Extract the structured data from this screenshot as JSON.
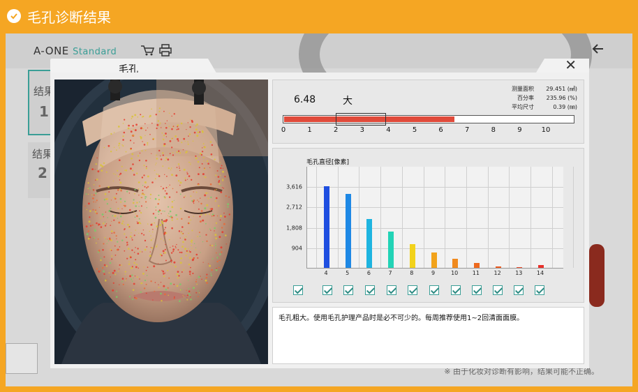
{
  "titlebar": {
    "title": "毛孔诊断结果",
    "icon": "check-circle-icon"
  },
  "bg_app": {
    "logo_main": "A-ONE",
    "logo_sub": "Standard",
    "frag_1": "结果",
    "frag_1_value": "1",
    "frag_2": "结果",
    "frag_2_value": "2",
    "bottom_note": "※ 由于化妆对诊断有影响，结果可能不正确。"
  },
  "dialog": {
    "tab_label": "毛孔",
    "close_symbol": "✕",
    "summary": {
      "score": "6.48",
      "level": "大",
      "stats": [
        {
          "label": "测量面积",
          "value": "29.451 (㎟)"
        },
        {
          "label": "百分率",
          "value": "235.96 (%)"
        },
        {
          "label": "平均尺寸",
          "value": "0.39 (㎜)"
        }
      ],
      "scale": {
        "min": 0,
        "max": 10,
        "value": 6.48,
        "normal_range": [
          2,
          3.9
        ]
      },
      "ticks": [
        "0",
        "1",
        "2",
        "3",
        "4",
        "5",
        "6",
        "7",
        "8",
        "9",
        "10"
      ]
    },
    "advice": "毛孔粗大。使用毛孔护理产品时是必不可少的。每周推荐使用1~2回清面面膜。"
  },
  "chart_data": {
    "type": "bar",
    "title": "毛孔直径[像素]",
    "categories": [
      "4",
      "5",
      "6",
      "7",
      "8",
      "9",
      "10",
      "11",
      "12",
      "13",
      "14"
    ],
    "values": [
      3616,
      3290,
      2180,
      1600,
      1040,
      680,
      400,
      220,
      60,
      30,
      120
    ],
    "colors": [
      "#1f4fe0",
      "#1e88e5",
      "#1eb4e0",
      "#22d3b6",
      "#f2d21b",
      "#f2a31b",
      "#f08a1e",
      "#ee6a1e",
      "#ec5a1e",
      "#eb4a2a",
      "#e8302a"
    ],
    "y_ticks": [
      "904",
      "1,808",
      "2,712",
      "3,616"
    ],
    "ylim": [
      0,
      4520
    ],
    "grid": true,
    "checkboxes": [
      true,
      true,
      true,
      true,
      true,
      true,
      true,
      true,
      true,
      true,
      true,
      true
    ]
  }
}
